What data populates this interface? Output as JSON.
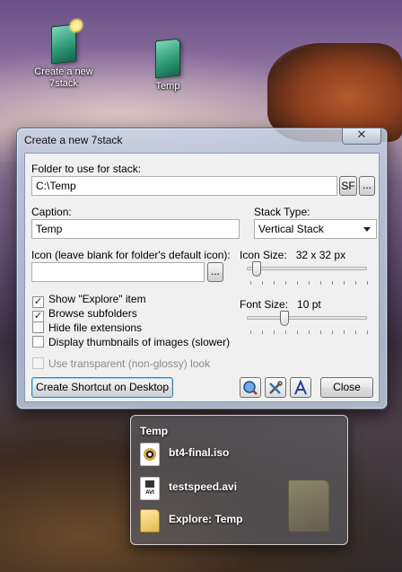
{
  "desktop": {
    "icons": [
      {
        "label_line1": "Create a new",
        "label_line2": "7stack"
      },
      {
        "label_line1": "Temp"
      }
    ]
  },
  "dialog": {
    "title": "Create a new 7stack",
    "close_glyph": "✕",
    "folder_label": "Folder to use for stack:",
    "folder_value": "C:\\Temp",
    "sf_button": "SF",
    "browse_button": "...",
    "caption_label": "Caption:",
    "caption_value": "Temp",
    "stack_type_label": "Stack Type:",
    "stack_type_value": "Vertical Stack",
    "icon_label": "Icon (leave blank for folder's default icon):",
    "icon_value": "",
    "icon_browse_button": "...",
    "icon_size_label": "Icon Size:",
    "icon_size_value": "32 x 32 px",
    "icon_size_level": 0.05,
    "font_size_label": "Font Size:",
    "font_size_value": "10 pt",
    "font_size_level": 0.3,
    "checkboxes": [
      {
        "label": "Show \"Explore\" item",
        "checked": true
      },
      {
        "label": "Browse subfolders",
        "checked": true
      },
      {
        "label": "Hide file extensions",
        "checked": false
      },
      {
        "label": "Display thumbnails of images (slower)",
        "checked": false
      }
    ],
    "transparent_label": "Use transparent (non-glossy) look",
    "create_shortcut_button": "Create Shortcut on Desktop",
    "close_button": "Close",
    "tool_icons": [
      "search-globe-icon",
      "tools-icon",
      "font-icon"
    ]
  },
  "stack_popup": {
    "title": "Temp",
    "items": [
      {
        "label": "bt4-final.iso",
        "icon": "disc-image-icon"
      },
      {
        "label": "testspeed.avi",
        "icon": "video-file-icon",
        "badge": "AVI"
      },
      {
        "label": "Explore: Temp",
        "icon": "folder-icon"
      }
    ]
  }
}
